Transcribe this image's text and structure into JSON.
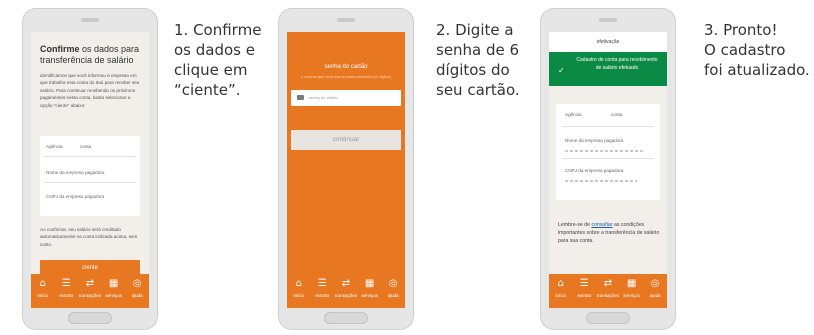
{
  "steps": [
    {
      "caption": "1. Confirme\nos dados e\nclique em\n“ciente”."
    },
    {
      "caption": "2. Digite a\nsenha de 6\ndígitos do\nseu cartão."
    },
    {
      "caption": "3. Pronto!\nO cadastro\nfoi atualizado."
    }
  ],
  "screen1": {
    "title_bold": "Confirme",
    "title_rest": " os dados para transferência de salário",
    "intro": "identificamos que você informou à empresa em que trabalha esta conta do Itaú para receber seu salário. Para continuar recebendo os próximos pagamentos nesta conta, basta selecionar a opção \"ciente\" abaixo:",
    "fields": {
      "agencia": "Agência",
      "conta": "conta",
      "empresa": "Nome da empresa pagadora",
      "cnpj": "CNPJ da empresa pagadora"
    },
    "note": "Ao confirmar, seu salário será creditado automaticamente na conta indicada acima, sem custo.",
    "button": "ciente"
  },
  "screen2": {
    "title": "senha do cartão",
    "subtitle": "a mesma que você usa no caixa eletrônico (6 dígitos)",
    "pin_placeholder": "senha do cartão",
    "button": "continuar"
  },
  "screen3": {
    "header": "efetivação",
    "banner": "Cadastro de conta para recebimento de salário efetuado",
    "fields": {
      "agencia": "Agência",
      "conta": "conta",
      "empresa": "Nome da empresa pagadora",
      "cnpj": "CNPJ da empresa pagadora"
    },
    "info_pre": "Lembre-se de ",
    "info_link": "consultar",
    "info_post": " as condições importantes sobre a transferência de salário para sua conta."
  },
  "tabbar": [
    {
      "label": "início",
      "icon": "home-icon"
    },
    {
      "label": "extrato",
      "icon": "statement-icon"
    },
    {
      "label": "transações",
      "icon": "transactions-icon"
    },
    {
      "label": "serviços",
      "icon": "services-icon"
    },
    {
      "label": "ajuda",
      "icon": "help-icon"
    }
  ],
  "colors": {
    "brand_orange": "#e87722",
    "success_green": "#0b8a45",
    "screen_bg": "#f2eeea"
  }
}
